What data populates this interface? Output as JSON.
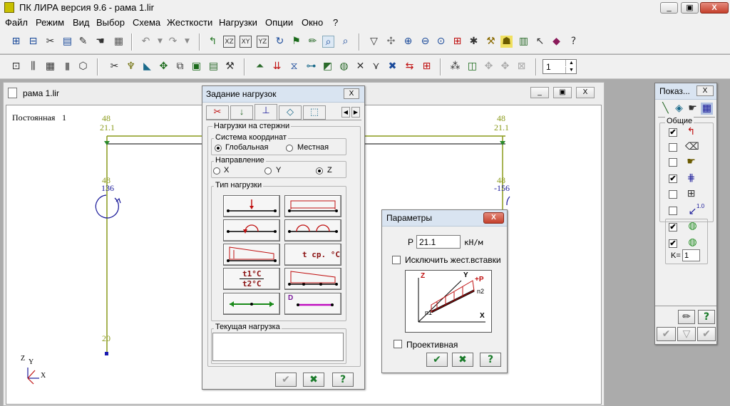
{
  "app": {
    "title": "ПК ЛИРА  версия 9.6 - рама 1.lir"
  },
  "window_controls": {
    "minimize": "_",
    "maximize": "▣",
    "close": "X"
  },
  "menu": [
    "Файл",
    "Режим",
    "Вид",
    "Выбор",
    "Схема",
    "Жесткости",
    "Нагрузки",
    "Опции",
    "Окно",
    "?"
  ],
  "toolbar": {
    "spin_value": "1"
  },
  "document": {
    "title": "рама 1.lir",
    "load_case_label": "Постоянная",
    "load_case_number": "1",
    "labels": {
      "left_top_a": "48",
      "left_top_b": "21.1",
      "right_top_a": "48",
      "right_top_b": "21.1",
      "left_mid_a": "48",
      "left_mid_b": "136",
      "right_mid_a": "48",
      "right_mid_b": "-156",
      "left_bottom": "20"
    },
    "axes": {
      "z": "Z",
      "y": "Y",
      "x": "X"
    }
  },
  "load_dialog": {
    "title": "Задание нагрузок",
    "section": "Нагрузки на стержни",
    "coord_group": "Система координат",
    "coord_options": [
      "Глобальная",
      "Местная"
    ],
    "direction_group": "Направление",
    "direction_options": [
      "X",
      "Y",
      "Z"
    ],
    "type_group": "Тип нагрузки",
    "current_group": "Текущая нагрузка",
    "type_temp1": "t ср. °C",
    "type_temp2a": "t1°C",
    "type_temp2b": "t2°C",
    "type_d": "D"
  },
  "params_dialog": {
    "title": "Параметры",
    "p_label": "P",
    "p_value": "21.1",
    "unit": "кН/м",
    "exclude_label": "Исключить жест.вставки",
    "projective_label": "Проективная",
    "diagram": {
      "z": "Z",
      "y": "Y",
      "x": "X",
      "p": "+P",
      "n1": "n1",
      "n2": "n2"
    }
  },
  "show_panel": {
    "title": "Показ...",
    "group": "Общие",
    "k_label": "K=",
    "k_value": "1",
    "arrow_label": "1.0"
  }
}
